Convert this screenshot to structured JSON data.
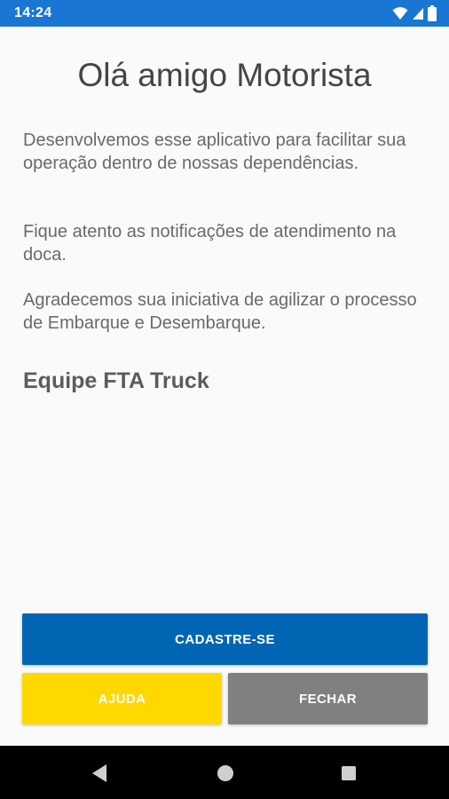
{
  "status_bar": {
    "time": "14:24",
    "icons": [
      "wifi-icon",
      "signal-icon",
      "battery-icon"
    ],
    "color": "#1976d2"
  },
  "welcome": {
    "title": "Olá amigo Motorista",
    "paragraphs": [
      "Desenvolvemos esse aplicativo para facilitar sua operação dentro de nossas dependências.",
      "Fique atento as notificações de atendimento na doca.",
      "Agradecemos sua iniciativa de agilizar o processo de Embarque e Desembarque."
    ],
    "signature": "Equipe FTA Truck"
  },
  "actions": {
    "register_label": "CADASTRE-SE",
    "help_label": "AJUDA",
    "close_label": "FECHAR",
    "register_color": "#0066b3",
    "help_color": "#ffd800",
    "close_color": "#808080"
  },
  "nav_bar": {
    "icons": [
      "back-icon",
      "home-icon",
      "recents-icon"
    ]
  }
}
